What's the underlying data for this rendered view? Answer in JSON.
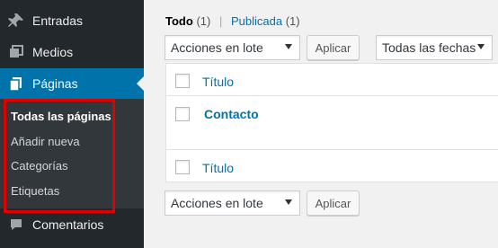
{
  "sidebar": {
    "items": [
      {
        "label": "Entradas",
        "icon": "pin-icon"
      },
      {
        "label": "Medios",
        "icon": "media-icon"
      },
      {
        "label": "Páginas",
        "icon": "pages-icon"
      },
      {
        "label": "Comentarios",
        "icon": "comment-icon"
      }
    ],
    "submenu": [
      {
        "label": "Todas las páginas"
      },
      {
        "label": "Añadir nueva"
      },
      {
        "label": "Categorías"
      },
      {
        "label": "Etiquetas"
      }
    ],
    "active_color": "#0073aa",
    "highlight_color": "#e00000"
  },
  "views": {
    "all_label": "Todo",
    "all_count": "(1)",
    "separator": "|",
    "published_label": "Publicada",
    "published_count": "(1)"
  },
  "top_nav": {
    "bulk_actions": "Acciones en lote",
    "apply": "Aplicar",
    "date_filter": "Todas las fechas"
  },
  "table": {
    "header_title": "Título",
    "footer_title": "Título",
    "rows": [
      {
        "title": "Contacto"
      }
    ]
  },
  "bottom_nav": {
    "bulk_actions": "Acciones en lote",
    "apply": "Aplicar"
  }
}
